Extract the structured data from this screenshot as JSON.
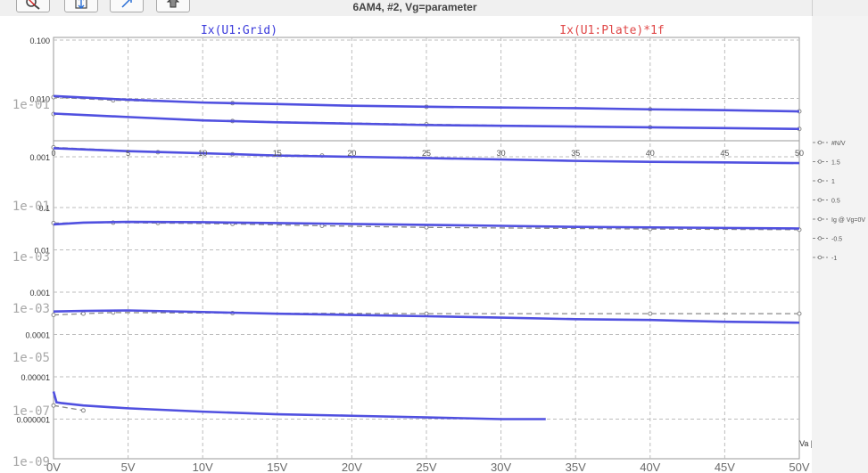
{
  "window": {
    "title": "6AM4, #2, Vg=parameter"
  },
  "toolbar": {
    "buttons": [
      {
        "name": "zoom-reset-button",
        "icon": "magnifier-icon"
      },
      {
        "name": "autoscale-button",
        "icon": "fit-vertical-icon"
      },
      {
        "name": "zoom-expand-button",
        "icon": "expand-diagonal-icon"
      },
      {
        "name": "cursor-tool-button",
        "icon": "hand-icon"
      }
    ]
  },
  "colors": {
    "sim": "#5050e0",
    "meas": "#888888",
    "trace_title_1": "#3b3bdb",
    "trace_title_2": "#e04848"
  },
  "chart_data": {
    "type": "line",
    "trace_titles": [
      "Ix(U1:Grid)",
      "Ix(U1:Plate)*1f"
    ],
    "x_axis": {
      "ticks": [
        "0V",
        "5V",
        "10V",
        "15V",
        "20V",
        "25V",
        "30V",
        "35V",
        "40V",
        "45V",
        "50V"
      ],
      "range": [
        0,
        50
      ],
      "unit_label": "Va [V]"
    },
    "inner_x_ticks": [
      "0",
      "5",
      "10",
      "15",
      "20",
      "25",
      "30",
      "35",
      "40",
      "45",
      "50"
    ],
    "ghost_y_labels": [
      "1e-01",
      "1e-01",
      "1e-03",
      "1e-03",
      "1e-05",
      "1e-07",
      "1e-09"
    ],
    "legend": [
      "#N/V",
      "1.5",
      "1",
      "0.5",
      "Ig @ Vg=0V",
      "-0.5",
      "-1"
    ],
    "panels": [
      {
        "name": "plate-current-panel",
        "scale": "log",
        "y_range": [
          0.001,
          0.1
        ],
        "y_ticks": [
          "0.100",
          "0.010",
          "0.001"
        ],
        "series": [
          {
            "x": [
              0,
              5,
              10,
              15,
              20,
              25,
              30,
              35,
              40,
              45,
              50
            ],
            "y": [
              0.011,
              0.0095,
              0.0085,
              0.008,
              0.0075,
              0.0072,
              0.007,
              0.0068,
              0.0065,
              0.0063,
              0.006
            ]
          },
          {
            "x": [
              0,
              5,
              10,
              15,
              20,
              25,
              30,
              35,
              40,
              45,
              50
            ],
            "y": [
              0.0055,
              0.0048,
              0.0042,
              0.0039,
              0.0037,
              0.0035,
              0.0034,
              0.0033,
              0.0032,
              0.0031,
              0.003
            ]
          },
          {
            "x": [
              0,
              5,
              10,
              15,
              20,
              25,
              30,
              35,
              40,
              45,
              50
            ],
            "y": [
              0.0014,
              0.00125,
              0.00115,
              0.00105,
              0.001,
              0.00095,
              0.0009,
              0.00085,
              0.00082,
              0.0008,
              0.00078
            ]
          }
        ],
        "measured": [
          {
            "x": [
              0,
              4,
              12,
              25,
              40,
              50
            ],
            "y": [
              0.0105,
              0.0093,
              0.0083,
              0.0072,
              0.0065,
              0.006
            ]
          },
          {
            "x": [
              0,
              12,
              25,
              40,
              50
            ],
            "y": [
              0.0054,
              0.0041,
              0.0036,
              0.0032,
              0.003
            ]
          },
          {
            "x": [
              0,
              7,
              12,
              18
            ],
            "y": [
              0.00145,
              0.0012,
              0.0011,
              0.00105
            ]
          }
        ]
      },
      {
        "name": "grid-current-panel",
        "scale": "log",
        "y_range": [
          1e-07,
          0.1
        ],
        "y_ticks": [
          "0.1",
          "0.01",
          "0.001",
          "0.0001",
          "0.00001",
          "0.000001"
        ],
        "series": [
          {
            "x": [
              0,
              2,
              5,
              10,
              15,
              20,
              25,
              30,
              35,
              40,
              45,
              50
            ],
            "y": [
              0.04,
              0.044,
              0.046,
              0.045,
              0.043,
              0.041,
              0.039,
              0.037,
              0.035,
              0.034,
              0.033,
              0.032
            ]
          },
          {
            "x": [
              0,
              2,
              5,
              10,
              15,
              20,
              25,
              30,
              35,
              40,
              45,
              50
            ],
            "y": [
              0.00035,
              0.00036,
              0.00037,
              0.00034,
              0.00031,
              0.00029,
              0.00027,
              0.00025,
              0.00023,
              0.00022,
              0.0002,
              0.00019
            ]
          },
          {
            "x": [
              0,
              0.2,
              0.5,
              2,
              5,
              10,
              15,
              20,
              25,
              30,
              33
            ],
            "y": [
              4.5e-06,
              2.5e-06,
              2.4e-06,
              2.1e-06,
              1.8e-06,
              1.5e-06,
              1.3e-06,
              1.2e-06,
              1.1e-06,
              1e-06,
              1e-06
            ]
          }
        ],
        "measured": [
          {
            "x": [
              0,
              4,
              7,
              12,
              18,
              25,
              40,
              50
            ],
            "y": [
              0.043,
              0.044,
              0.043,
              0.041,
              0.037,
              0.034,
              0.031,
              0.03
            ]
          },
          {
            "x": [
              0,
              2,
              4,
              12,
              25,
              40,
              50
            ],
            "y": [
              0.00029,
              0.00031,
              0.00033,
              0.00032,
              0.00031,
              0.00031,
              0.00031
            ]
          },
          {
            "x": [
              0,
              2
            ],
            "y": [
              2.1e-06,
              1.6e-06
            ]
          }
        ]
      }
    ]
  }
}
